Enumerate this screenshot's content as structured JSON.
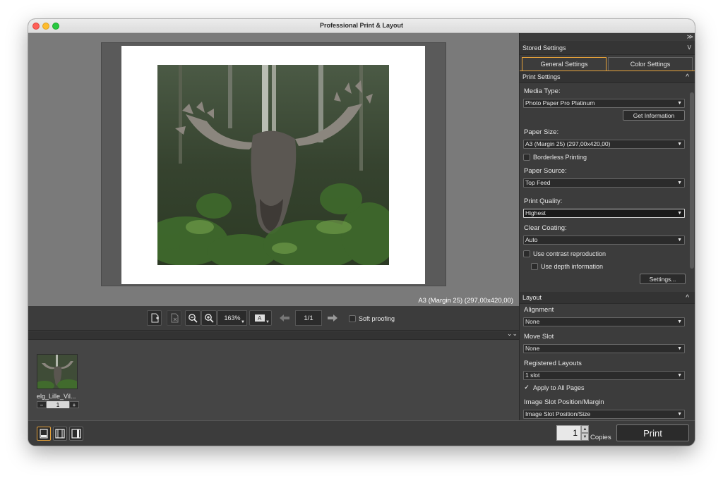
{
  "window": {
    "title": "Professional Print & Layout"
  },
  "preview": {
    "paper_size_label": "A3 (Margin 25) (297,00x420,00)"
  },
  "toolbar": {
    "zoom_value": "163%",
    "page_value": "1/1",
    "soft_proofing_label": "Soft proofing"
  },
  "thumbnails": [
    {
      "name": "elg_Lille_Vil...",
      "count": "1"
    }
  ],
  "bottom": {
    "copies_value": "1",
    "copies_label": "Copies",
    "print_label": "Print"
  },
  "panel": {
    "expand_glyph": "≫",
    "stored_settings_label": "Stored Settings",
    "tabs": [
      {
        "label": "General Settings",
        "active": true
      },
      {
        "label": "Color Settings",
        "active": false
      }
    ],
    "print_settings": {
      "header": "Print Settings",
      "media_type_label": "Media Type:",
      "media_type_value": "Photo Paper Pro Platinum",
      "get_info_label": "Get Information",
      "paper_size_label": "Paper Size:",
      "paper_size_value": "A3 (Margin 25) (297,00x420,00)",
      "borderless_label": "Borderless Printing",
      "paper_source_label": "Paper Source:",
      "paper_source_value": "Top Feed",
      "print_quality_label": "Print Quality:",
      "print_quality_value": "Highest",
      "clear_coating_label": "Clear Coating:",
      "clear_coating_value": "Auto",
      "contrast_label": "Use contrast reproduction",
      "depth_label": "Use depth information",
      "settings_button_label": "Settings..."
    },
    "layout": {
      "header": "Layout",
      "alignment_label": "Alignment",
      "alignment_value": "None",
      "move_slot_label": "Move Slot",
      "move_slot_value": "None",
      "registered_layouts_label": "Registered Layouts",
      "registered_layouts_value": "1 slot",
      "apply_all_label": "Apply to All Pages",
      "image_slot_label": "Image Slot Position/Margin",
      "image_slot_value": "Image Slot Position/Size"
    }
  },
  "colors": {
    "accent": "#e8a33a",
    "background": "#3c3c3c",
    "preview_bg": "#7a7a7a"
  }
}
